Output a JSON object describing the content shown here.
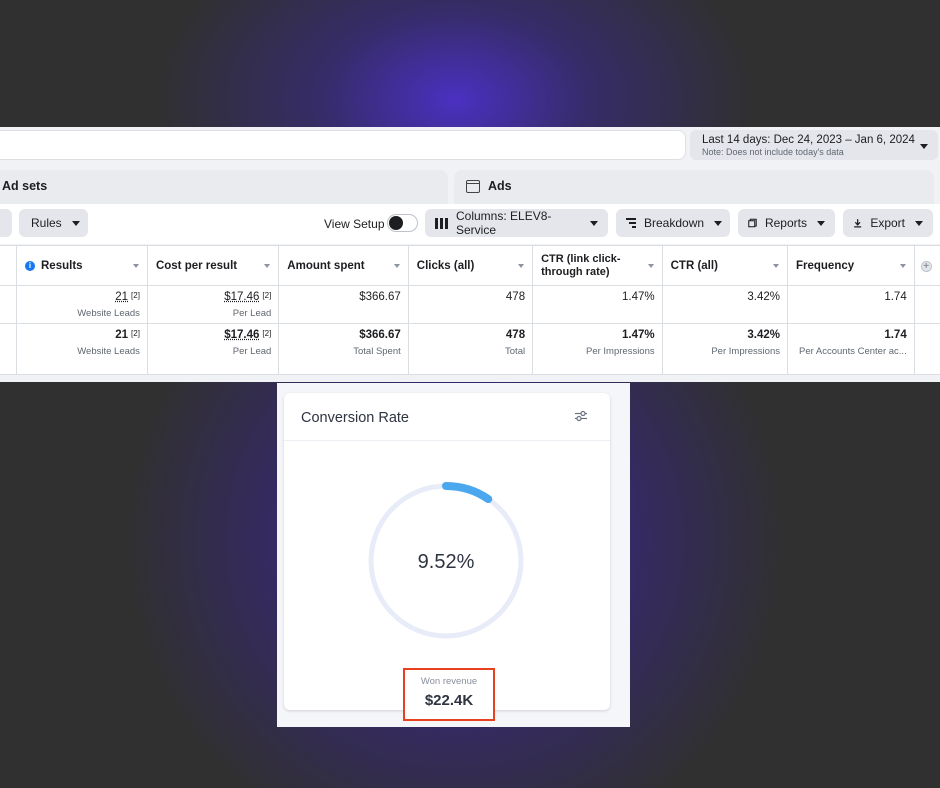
{
  "date_range": {
    "label": "Last 14 days: Dec 24, 2023 – Jan 6, 2024",
    "note": "Note: Does not include today's data"
  },
  "tabs": {
    "ad_sets": "Ad sets",
    "ads": "Ads"
  },
  "toolbar": {
    "rules": "Rules",
    "view_setup": "View Setup",
    "columns": "Columns: ELEV8- Service",
    "breakdown": "Breakdown",
    "reports": "Reports",
    "export": "Export"
  },
  "table": {
    "headers": {
      "results": "Results",
      "cost_per_result": "Cost per result",
      "amount_spent": "Amount spent",
      "clicks": "Clicks (all)",
      "ctr_link": "CTR (link click-through rate)",
      "ctr_all": "CTR (all)",
      "frequency": "Frequency"
    },
    "rows": [
      {
        "results": "21",
        "results_sup": "[2]",
        "results_sub": "Website Leads",
        "cost": "$17.46",
        "cost_sup": "[2]",
        "cost_sub": "Per Lead",
        "amount": "$366.67",
        "amount_sub": "",
        "clicks": "478",
        "clicks_sub": "",
        "ctr_link": "1.47%",
        "ctr_link_sub": "",
        "ctr_all": "3.42%",
        "ctr_all_sub": "",
        "frequency": "1.74",
        "frequency_sub": ""
      },
      {
        "results": "21",
        "results_sup": "[2]",
        "results_sub": "Website Leads",
        "cost": "$17.46",
        "cost_sup": "[2]",
        "cost_sub": "Per Lead",
        "amount": "$366.67",
        "amount_sub": "Total Spent",
        "clicks": "478",
        "clicks_sub": "Total",
        "ctr_link": "1.47%",
        "ctr_link_sub": "Per Impressions",
        "ctr_all": "3.42%",
        "ctr_all_sub": "Per Impressions",
        "frequency": "1.74",
        "frequency_sub": "Per Accounts Center ac..."
      }
    ]
  },
  "conversion_card": {
    "title": "Conversion Rate",
    "rate_label": "9.52%",
    "rate_value": 0.0952,
    "won_revenue_label": "Won revenue",
    "won_revenue_value": "$22.4K",
    "ring_color": "#4ba7ee",
    "track_color": "#e7ecf8",
    "highlight_color": "#e8411f"
  }
}
